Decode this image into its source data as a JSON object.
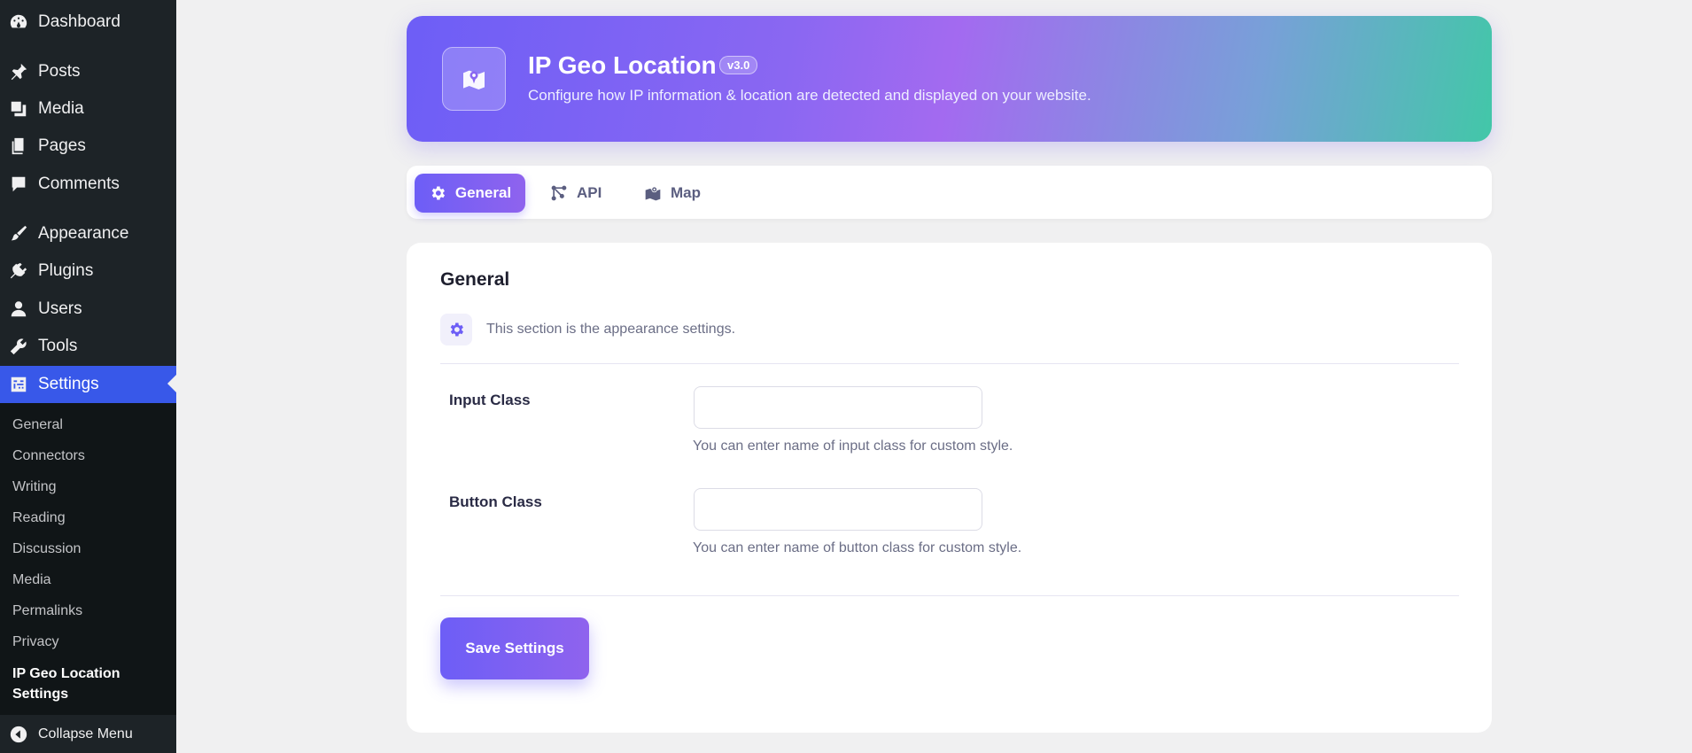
{
  "sidebar": {
    "items": [
      {
        "label": "Dashboard",
        "icon": "dashboard-icon"
      },
      {
        "label": "Posts",
        "icon": "pin-icon"
      },
      {
        "label": "Media",
        "icon": "media-icon"
      },
      {
        "label": "Pages",
        "icon": "pages-icon"
      },
      {
        "label": "Comments",
        "icon": "comment-icon"
      },
      {
        "label": "Appearance",
        "icon": "brush-icon"
      },
      {
        "label": "Plugins",
        "icon": "plug-icon"
      },
      {
        "label": "Users",
        "icon": "user-icon"
      },
      {
        "label": "Tools",
        "icon": "wrench-icon"
      },
      {
        "label": "Settings",
        "icon": "settings-icon"
      }
    ],
    "active_item": "Settings",
    "submenu": [
      "General",
      "Connectors",
      "Writing",
      "Reading",
      "Discussion",
      "Media",
      "Permalinks",
      "Privacy",
      "IP Geo Location Settings"
    ],
    "current_submenu": "IP Geo Location Settings",
    "collapse_label": "Collapse Menu"
  },
  "header": {
    "title": "IP Geo Location",
    "version": "v3.0",
    "subtitle": "Configure how IP information & location are detected and displayed on your website.",
    "icon": "map-pin-icon"
  },
  "tabs": [
    {
      "label": "General",
      "icon": "gear-icon",
      "active": true
    },
    {
      "label": "API",
      "icon": "api-icon",
      "active": false
    },
    {
      "label": "Map",
      "icon": "map-icon",
      "active": false
    }
  ],
  "card": {
    "title": "General",
    "section_description": "This section is the appearance settings.",
    "fields": [
      {
        "label": "Input Class",
        "value": "",
        "help": "You can enter name of input class for custom style."
      },
      {
        "label": "Button Class",
        "value": "",
        "help": "You can enter name of button class for custom style."
      }
    ],
    "save_label": "Save Settings"
  },
  "colors": {
    "sidebar_bg": "#1d2327",
    "active_menu": "#3858e9",
    "accent": "#6d5ef6",
    "banner_gradient_end": "#42c7a8"
  }
}
